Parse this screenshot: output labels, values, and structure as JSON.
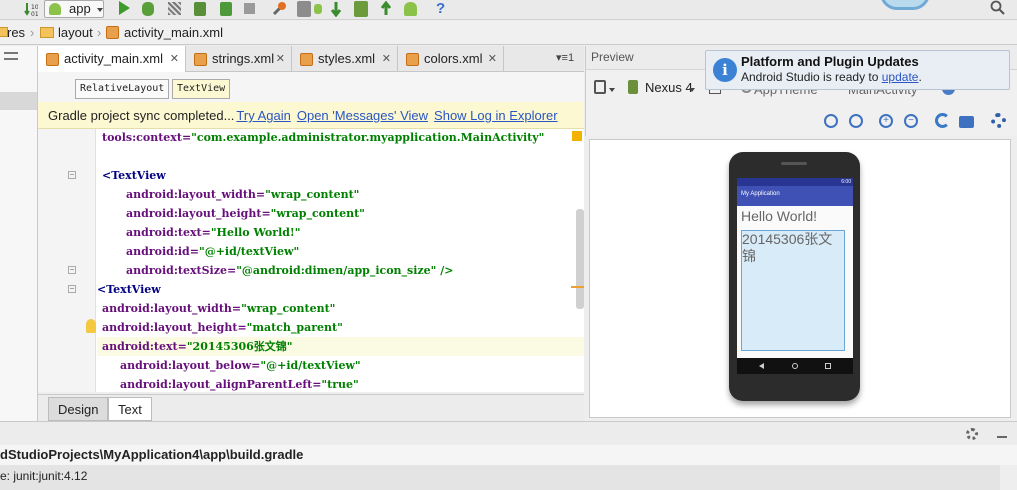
{
  "toolbar": {
    "module_selector": "app",
    "icons": [
      "build-icon",
      "run-icon",
      "debug-icon",
      "attach-icon",
      "coverage-icon",
      "stop-icon",
      "sdk-manager-icon",
      "avd-icon",
      "sync-icon",
      "device-monitor-icon",
      "android-icon",
      "help-icon"
    ]
  },
  "breadcrumb": {
    "items": [
      "res",
      "layout",
      "activity_main.xml"
    ]
  },
  "editor": {
    "tabs": [
      {
        "label": "activity_main.xml",
        "active": true
      },
      {
        "label": "strings.xml",
        "active": false
      },
      {
        "label": "styles.xml",
        "active": false
      },
      {
        "label": "colors.xml",
        "active": false
      }
    ],
    "overflow_label": "≡1",
    "xml_path": [
      "RelativeLayout",
      "TextView"
    ],
    "gradle_bar": {
      "message": "Gradle project sync completed...",
      "links": [
        "Try Again",
        "Open 'Messages' View",
        "Show Log in Explorer"
      ]
    },
    "code_lines": [
      {
        "indent": 1,
        "attr": "tools:context=",
        "value": "\"com.example.administrator.myapplication.MainActivity\""
      },
      {
        "indent": 0,
        "attr": "",
        "value": ""
      },
      {
        "indent": 1,
        "attr": "<TextView",
        "value": ""
      },
      {
        "indent": 2,
        "attr": "android:layout_width=",
        "value": "\"wrap_content\""
      },
      {
        "indent": 2,
        "attr": "android:layout_height=",
        "value": "\"wrap_content\""
      },
      {
        "indent": 2,
        "attr": "android:text=",
        "value": "\"Hello World!\""
      },
      {
        "indent": 2,
        "attr": "android:id=",
        "value": "\"@+id/textView\""
      },
      {
        "indent": 2,
        "attr": "android:textSize=",
        "value": "\"@android:dimen/app_icon_size\" />"
      },
      {
        "indent": 0,
        "attr": "<TextView",
        "value": ""
      },
      {
        "indent": 1,
        "attr": "android:layout_width=",
        "value": "\"wrap_content\""
      },
      {
        "indent": 1,
        "attr": "android:layout_height=",
        "value": "\"match_parent\""
      },
      {
        "indent": 1,
        "attr": "android:text=",
        "value": "\"20145306张文锦\""
      },
      {
        "indent": 3,
        "attr": "android:layout_below=",
        "value": "\"@+id/textView\""
      },
      {
        "indent": 3,
        "attr": "android:layout_alignParentLeft=",
        "value": "\"true\""
      }
    ],
    "mode_tabs": [
      "Design",
      "Text"
    ]
  },
  "preview": {
    "title": "Preview",
    "device": "Nexus 4",
    "theme": "AppTheme",
    "activity": "MainActivity",
    "app_name": "My Application",
    "status_time": "6:00",
    "hello_text": "Hello World!",
    "name_text": "20145306张文锦"
  },
  "notification": {
    "title": "Platform and Plugin Updates",
    "body_prefix": "Android Studio is ready to ",
    "body_link": "update",
    "body_suffix": "."
  },
  "bottom": {
    "path_line": "dStudioProjects\\MyApplication4\\app\\build.gradle",
    "dep_line": "e: junit:junit:4.12"
  }
}
